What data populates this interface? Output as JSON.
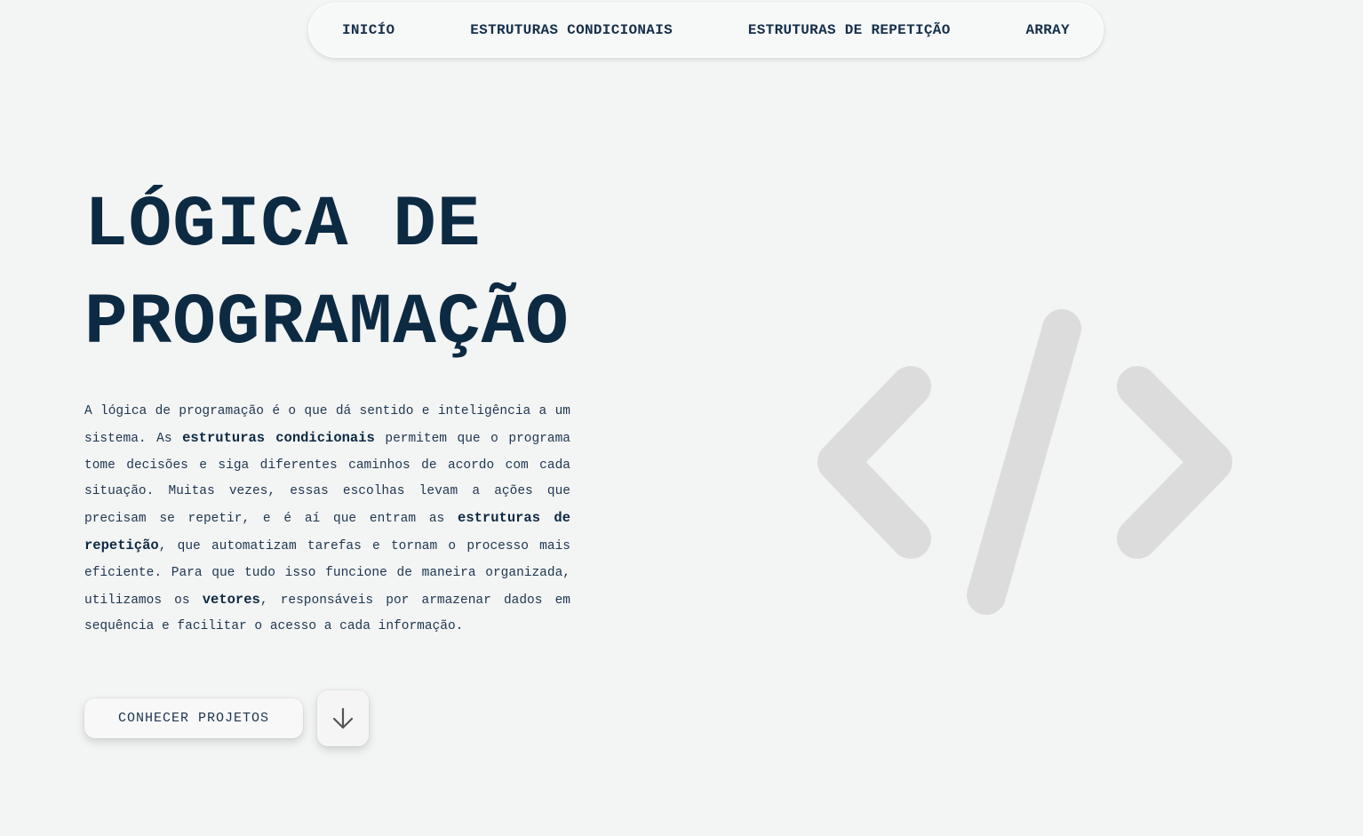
{
  "nav": {
    "items": [
      {
        "label": "INICÍO"
      },
      {
        "label": "ESTRUTURAS CONDICIONAIS"
      },
      {
        "label": "ESTRUTURAS DE REPETIÇÃO"
      },
      {
        "label": "ARRAY"
      }
    ]
  },
  "hero": {
    "title_line1": "LÓGICA DE",
    "title_line2": "PROGRAMAÇÃO",
    "desc": {
      "p1": "A lógica de programação é o que dá sentido e inteligência a um sistema. As ",
      "b1": "estruturas condicionais",
      "p2": " permitem que o programa tome decisões e siga diferentes caminhos de acordo com cada situação. Muitas vezes, essas escolhas levam a ações que precisam se repetir, e é aí que entram as ",
      "b2": "estruturas de repetição",
      "p3": ", que automatizam tarefas e tornam o processo mais eficiente. Para que tudo isso funcione de maneira organizada, utilizamos os ",
      "b3": "vetores",
      "p4": ", responsáveis por armazenar dados em sequência e facilitar o acesso a cada informação."
    },
    "cta_label": "CONHECER PROJETOS"
  },
  "icons": {
    "down": "arrow-down-icon",
    "code": "code-brackets-icon"
  },
  "colors": {
    "background": "#f3f4f4",
    "text_primary": "#0d2a43",
    "icon_gray": "#dcdcdc"
  }
}
